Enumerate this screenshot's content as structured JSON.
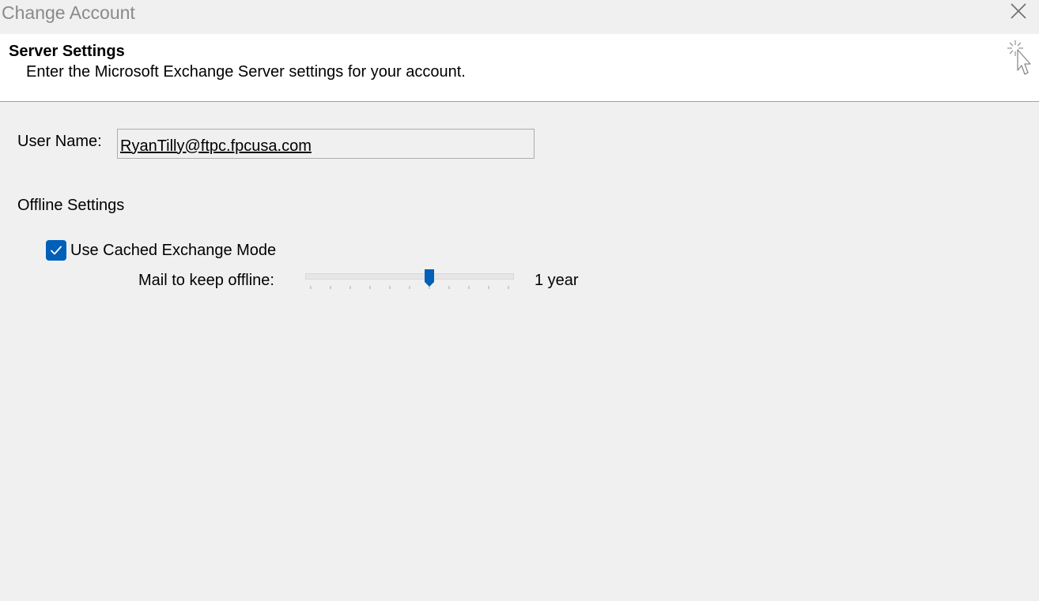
{
  "window": {
    "title": "Change Account",
    "close_icon": "close-icon"
  },
  "header": {
    "heading": "Server Settings",
    "subtitle": "Enter the Microsoft Exchange Server settings for your account.",
    "icon": "wizard-cursor-icon"
  },
  "account": {
    "user_name_label": "User Name:",
    "user_name_value": "RyanTilly@ftpc.fpcusa.com"
  },
  "offline": {
    "section_label": "Offline Settings",
    "cached_mode_label": "Use Cached Exchange Mode",
    "cached_mode_checked": true,
    "mail_offline_label": "Mail to keep offline:",
    "mail_offline_value": "1 year",
    "slider_position": 0.6
  },
  "colors": {
    "accent": "#005fb8",
    "title_text": "#8a8a8a",
    "dialog_bg": "#f0f0f0",
    "header_bg": "#ffffff"
  }
}
